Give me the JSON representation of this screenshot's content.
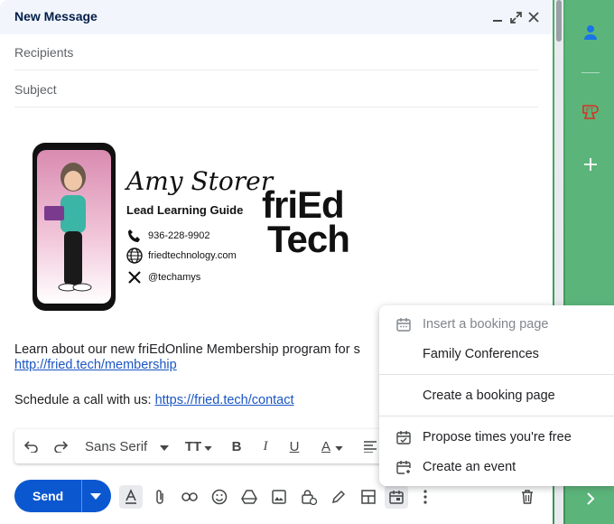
{
  "compose": {
    "title": "New Message",
    "recipients_label": "Recipients",
    "subject_label": "Subject"
  },
  "signature": {
    "name": "Amy Storer",
    "role": "Lead Learning Guide",
    "phone": "936-228-9902",
    "website": "friedtechnology.com",
    "social": "@techamys",
    "brand_line1": "friEd",
    "brand_line2": "Tech"
  },
  "body": {
    "line1": "Learn about our new friEdOnline Membership program for s",
    "link1": "http://fried.tech/membership",
    "line2_prefix": "Schedule a call with us: ",
    "link2": "https://fried.tech/contact"
  },
  "formatting": {
    "font": "Sans Serif",
    "size_icon": "TT",
    "bold": "B",
    "italic": "I",
    "underline": "U",
    "text_color": "A"
  },
  "toolbar": {
    "send_label": "Send"
  },
  "menu": {
    "insert_booking": "Insert a booking page",
    "family_conferences": "Family Conferences",
    "create_booking": "Create a booking page",
    "propose_times": "Propose times you're free",
    "create_event": "Create an event"
  },
  "colors": {
    "accent": "#0b57d0",
    "link": "#1a56c4",
    "sidebar_green": "#4caf6a"
  }
}
